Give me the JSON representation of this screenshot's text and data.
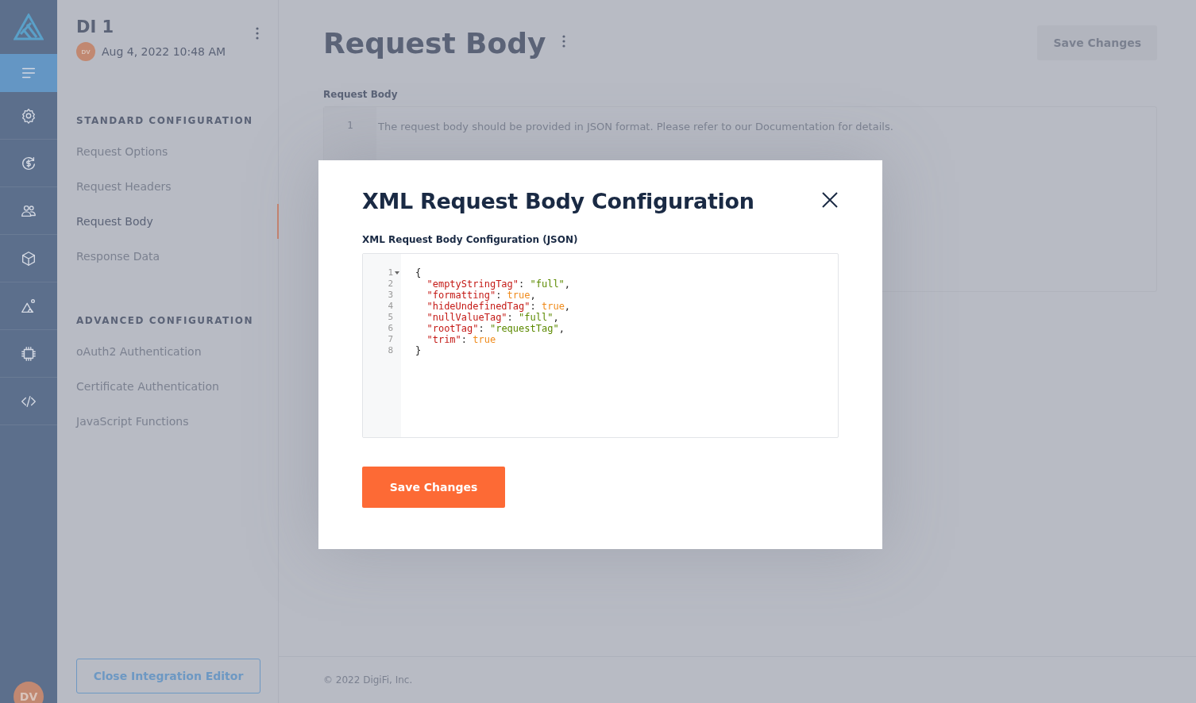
{
  "nav_rail": {
    "items": [
      {
        "kind": "menu",
        "selected": true
      },
      {
        "kind": "settings",
        "selected": false
      },
      {
        "kind": "billing",
        "selected": false
      },
      {
        "kind": "users",
        "selected": false
      },
      {
        "kind": "box",
        "selected": false
      },
      {
        "kind": "image",
        "selected": false
      },
      {
        "kind": "chip",
        "selected": false
      },
      {
        "kind": "code",
        "selected": false
      }
    ],
    "user_avatar": "DV"
  },
  "sidebar": {
    "title": "DI 1",
    "author_avatar": "DV",
    "date": "Aug 4, 2022 10:48 AM",
    "sections": [
      {
        "heading": "STANDARD CONFIGURATION",
        "items": [
          {
            "label": "Request Options",
            "selected": false
          },
          {
            "label": "Request Headers",
            "selected": false
          },
          {
            "label": "Request Body",
            "selected": true
          },
          {
            "label": "Response Data",
            "selected": false
          }
        ]
      },
      {
        "heading": "ADVANCED CONFIGURATION",
        "items": [
          {
            "label": "oAuth2 Authentication",
            "selected": false
          },
          {
            "label": "Certificate Authentication",
            "selected": false
          },
          {
            "label": "JavaScript Functions",
            "selected": false
          }
        ]
      }
    ],
    "close_button": "Close Integration Editor"
  },
  "main": {
    "title": "Request Body",
    "save_button": {
      "label": "Save Changes",
      "disabled": true
    },
    "field_label": "Request Body",
    "editor": {
      "line_number": "1",
      "placeholder": "The request body should be provided in JSON format. Please refer to our Documentation for details."
    },
    "footer": "© 2022 DigiFi, Inc."
  },
  "dialog": {
    "title": "XML Request Body Configuration",
    "field_label": "XML Request Body Configuration (JSON)",
    "code_lines": [
      {
        "number": "1",
        "text": "{",
        "foldable": true
      },
      {
        "number": "2",
        "text": "  \"emptyStringTag\": \"full\",",
        "foldable": false
      },
      {
        "number": "3",
        "text": "  \"formatting\": true,",
        "foldable": false
      },
      {
        "number": "4",
        "text": "  \"hideUndefinedTag\": true,",
        "foldable": false
      },
      {
        "number": "5",
        "text": "  \"nullValueTag\": \"full\",",
        "foldable": false
      },
      {
        "number": "6",
        "text": "  \"rootTag\": \"requestTag\",",
        "foldable": false
      },
      {
        "number": "7",
        "text": "  \"trim\": true",
        "foldable": false
      },
      {
        "number": "8",
        "text": "}",
        "foldable": false
      }
    ],
    "save_button": "Save Changes"
  }
}
